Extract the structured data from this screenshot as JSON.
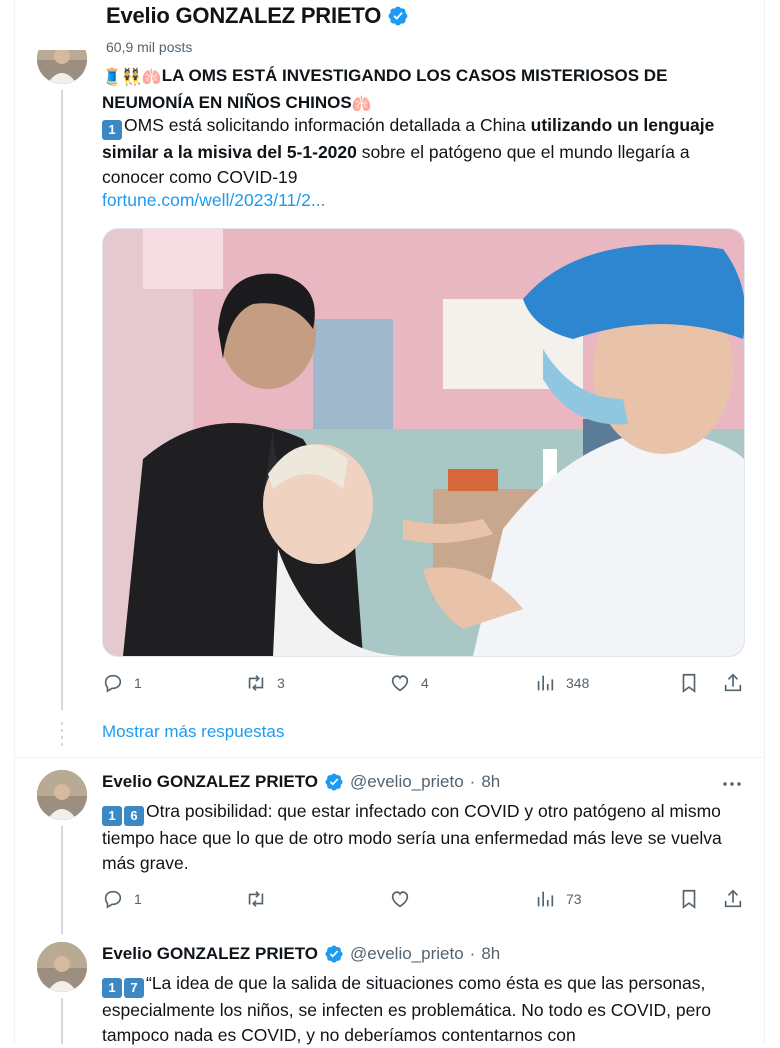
{
  "profile": {
    "name": "Evelio GONZALEZ PRIETO",
    "posts": "60,9 mil posts"
  },
  "tweet_main": {
    "emojis_leading": "🧵👯🫁",
    "title_line1": "LA OMS ESTÁ INVESTIGANDO LOS CASOS MISTERIOSOS DE",
    "title_line2": "NEUMONÍA EN NIÑOS CHINOS",
    "title_emoji_end": "🫁",
    "num_badge": "1",
    "body_a": "OMS está solicitando información detallada a China ",
    "body_bold": "utilizando un lenguaje similar a la misiva del 5-1-2020",
    "body_b": " sobre el patógeno que el mundo llegaría a conocer como COVID-19",
    "link": "fortune.com/well/2023/11/2...",
    "stats": {
      "replies": "1",
      "retweets": "3",
      "likes": "4",
      "views": "348"
    }
  },
  "show_more": "Mostrar más respuestas",
  "reply1": {
    "name": "Evelio GONZALEZ PRIETO",
    "handle": "@evelio_prieto",
    "dot": "·",
    "time": "8h",
    "num_badges": [
      "1",
      "6"
    ],
    "text": "Otra posibilidad: que estar infectado con COVID y otro patógeno al mismo tiempo hace que lo que de otro modo sería una enfermedad más leve se vuelva más grave.",
    "stats": {
      "replies": "1",
      "retweets": "",
      "likes": "",
      "views": "73"
    }
  },
  "reply2": {
    "name": "Evelio GONZALEZ PRIETO",
    "handle": "@evelio_prieto",
    "dot": "·",
    "time": "8h",
    "num_badges": [
      "1",
      "7"
    ],
    "text": "“La idea de que la salida de situaciones como ésta es que las personas, especialmente los niños, se infecten es problemática. No todo es COVID, pero tampoco nada es COVID, y no deberíamos contentarnos con"
  },
  "colors": {
    "accent": "#1d9bf0",
    "verified": "#1d9bf0",
    "muted": "#536471",
    "emoji_keycap": "#3b88c3"
  },
  "icons": [
    "verified-badge-icon",
    "reply-icon",
    "retweet-icon",
    "like-icon",
    "views-icon",
    "bookmark-icon",
    "share-icon",
    "more-icon"
  ]
}
